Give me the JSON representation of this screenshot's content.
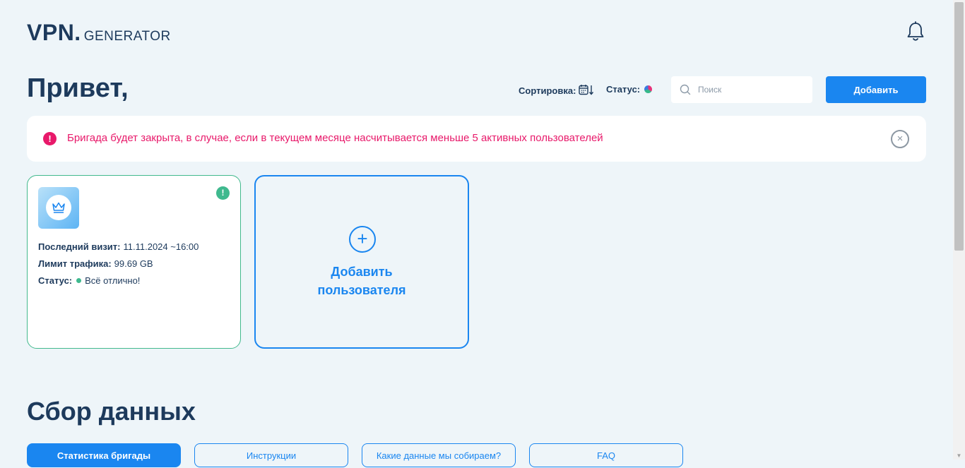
{
  "logo": {
    "vpn": "VPN.",
    "generator": "GENERATOR"
  },
  "greeting": "Привет,",
  "toolbar": {
    "sort_label": "Сортировка:",
    "status_label": "Статус:",
    "search_placeholder": "Поиск",
    "add_button": "Добавить"
  },
  "alert": {
    "icon": "!",
    "text": "Бригада будет закрыта, в случае, если в текущем месяце насчитывается меньше 5 активных пользователей",
    "close": "×"
  },
  "user_card": {
    "warning_icon": "!",
    "last_visit_label": "Последний визит:",
    "last_visit_value": "11.11.2024 ~16:00",
    "traffic_label": "Лимит трафика:",
    "traffic_value": "99.69 GB",
    "status_label": "Статус:",
    "status_value": "Всё отлично!"
  },
  "add_user": {
    "plus": "+",
    "label_line1": "Добавить",
    "label_line2": "пользователя"
  },
  "data_section": {
    "title": "Сбор данных",
    "tabs": [
      {
        "label": "Статистика бригады"
      },
      {
        "label": "Инструкции"
      },
      {
        "label": "Какие данные мы собираем?"
      },
      {
        "label": "FAQ"
      }
    ]
  },
  "colors": {
    "accent": "#1a86f0",
    "alert": "#e8196a",
    "success": "#3fb98e",
    "text": "#1d3a5c",
    "background": "#eef5f9"
  },
  "icons": [
    "bell-icon",
    "calendar-sort-icon",
    "status-pie-icon",
    "search-icon",
    "alert-icon",
    "close-icon",
    "crown-icon",
    "warning-icon",
    "plus-icon"
  ]
}
